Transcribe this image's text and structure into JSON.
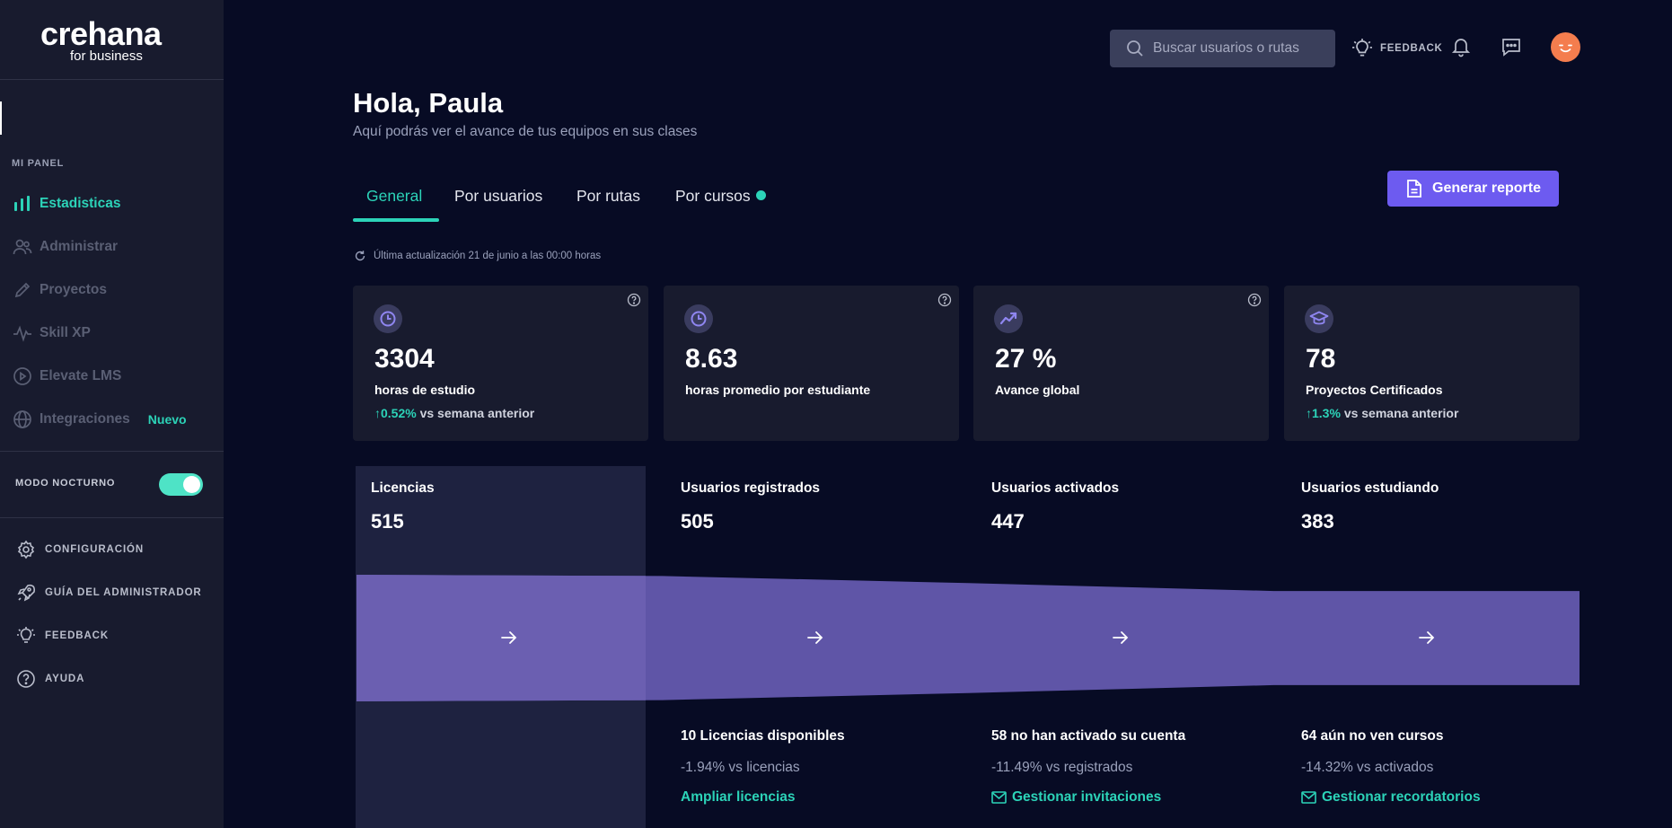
{
  "brand": {
    "name": "crehana",
    "sub": "for business"
  },
  "sidebar": {
    "section_title": "MI PANEL",
    "items": [
      {
        "label": "Estadisticas",
        "icon": "bar-chart-icon",
        "active": true
      },
      {
        "label": "Administrar",
        "icon": "users-icon"
      },
      {
        "label": "Proyectos",
        "icon": "pencil-icon"
      },
      {
        "label": "Skill XP",
        "icon": "pulse-icon"
      },
      {
        "label": "Elevate LMS",
        "icon": "play-circle-icon"
      },
      {
        "label": "Integraciones",
        "icon": "globe-icon",
        "badge": "Nuevo"
      }
    ],
    "night_mode": {
      "label": "MODO NOCTURNO",
      "enabled": true
    },
    "aux_items": [
      {
        "label": "CONFIGURACIÓN",
        "icon": "gear-icon"
      },
      {
        "label": "GUÍA DEL ADMINISTRADOR",
        "icon": "rocket-icon"
      },
      {
        "label": "FEEDBACK",
        "icon": "lightbulb-icon"
      },
      {
        "label": "AYUDA",
        "icon": "help-circle-icon"
      }
    ]
  },
  "header": {
    "search_placeholder": "Buscar usuarios o rutas",
    "feedback_label": "FEEDBACK"
  },
  "greeting": "Hola, Paula",
  "subtitle": "Aquí podrás ver el avance de tus equipos en sus clases",
  "tabs": [
    {
      "label": "General",
      "active": true
    },
    {
      "label": "Por usuarios"
    },
    {
      "label": "Por rutas"
    },
    {
      "label": "Por cursos",
      "dot": true
    }
  ],
  "report_button": "Generar reporte",
  "last_update": "Última actualización 21 de junio a las 00:00 horas",
  "stats": [
    {
      "icon": "clock-icon",
      "value": "3304",
      "label": "horas de estudio",
      "trend": "0.52%",
      "trend_suffix": "vs semana anterior"
    },
    {
      "icon": "clock-icon",
      "value": "8.63",
      "label": "horas promedio por estudiante"
    },
    {
      "icon": "trend-up-icon",
      "value": "27 %",
      "label": "Avance global"
    },
    {
      "icon": "graduation-cap-icon",
      "value": "78",
      "label": "Proyectos Certificados",
      "trend": "1.3%",
      "trend_suffix": "vs semana anterior"
    }
  ],
  "funnel": {
    "stages": [
      {
        "title": "Licencias",
        "value": "515",
        "count": 515
      },
      {
        "title": "Usuarios registrados",
        "value": "505",
        "count": 505
      },
      {
        "title": "Usuarios activados",
        "value": "447",
        "count": 447
      },
      {
        "title": "Usuarios estudiando",
        "value": "383",
        "count": 383
      }
    ],
    "footers": [
      {
        "title": "10 Licencias disponibles",
        "sub": "-1.94% vs licencias",
        "link": "Ampliar licencias",
        "link_icon": ""
      },
      {
        "title": "58 no han activado su cuenta",
        "sub": "-11.49% vs registrados",
        "link": "Gestionar invitaciones",
        "link_icon": "mail-icon"
      },
      {
        "title": "64 aún no ven cursos",
        "sub": "-14.32% vs activados",
        "link": "Gestionar recordatorios",
        "link_icon": "mail-icon"
      }
    ],
    "colors": {
      "band": "#5f55a7",
      "band_first": "#6b5fb1"
    }
  }
}
